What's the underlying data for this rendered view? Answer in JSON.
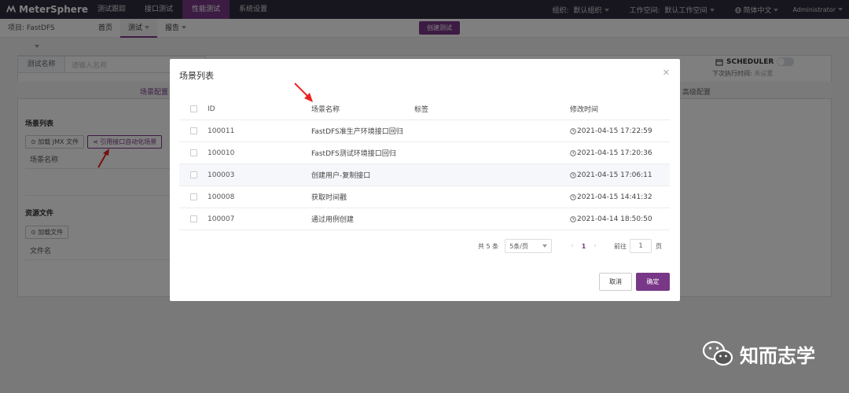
{
  "app": {
    "brand": "MeterSphere"
  },
  "topnav": {
    "items": [
      "测试跟踪",
      "接口测试",
      "性能测试",
      "系统设置"
    ],
    "active_index": 2,
    "org_label": "组织:",
    "org_value": "默认组织",
    "workspace_label": "工作空间:",
    "workspace_value": "默认工作空间",
    "language": "简体中文",
    "user": "Administrator"
  },
  "subnav": {
    "project": "项目: FastDFS",
    "items": [
      "首页",
      "测试",
      "报告"
    ],
    "active_index": 1,
    "create_button": "创建测试"
  },
  "background": {
    "name_label": "测试名称",
    "name_placeholder": "请输入名称",
    "tab_scene_config": "场景配置",
    "tab_advanced_config": "高级配置",
    "scene_list_title": "场景列表",
    "load_jmx_button": "加载 JMX 文件",
    "reference_scene_button": "引用接口自动化场景",
    "scene_name_label": "场景名称",
    "resource_files_title": "资源文件",
    "load_file_button": "加载文件",
    "file_name_label": "文件名",
    "scheduler_label": "SCHEDULER",
    "next_run_label": "下次执行时间:",
    "next_run_value": "未设置"
  },
  "dialog": {
    "title": "场景列表",
    "columns": {
      "id": "ID",
      "name": "场景名称",
      "tags": "标签",
      "modified": "修改时间"
    },
    "rows": [
      {
        "id": "100011",
        "name": "FastDFS准生产环境接口回归",
        "tags": "",
        "modified": "2021-04-15 17:22:59"
      },
      {
        "id": "100010",
        "name": "FastDFS测试环境接口回归",
        "tags": "",
        "modified": "2021-04-15 17:20:36"
      },
      {
        "id": "100003",
        "name": "创建用户-复制接口",
        "tags": "",
        "modified": "2021-04-15 17:06:11"
      },
      {
        "id": "100008",
        "name": "获取时间戳",
        "tags": "",
        "modified": "2021-04-15 14:41:32"
      },
      {
        "id": "100007",
        "name": "通过用例创建",
        "tags": "",
        "modified": "2021-04-14 18:50:50"
      }
    ],
    "hover_row_index": 2,
    "pagination": {
      "total": "共 5 条",
      "page_size": "5条/页",
      "current_page": "1",
      "goto_label": "前往",
      "goto_value": "1",
      "goto_unit": "页"
    },
    "cancel_button": "取消",
    "confirm_button": "确定"
  },
  "watermark": {
    "text": "知而志学"
  },
  "colors": {
    "accent": "#783887",
    "topbar": "#2e2a3d",
    "annotation": "#e8231e"
  }
}
